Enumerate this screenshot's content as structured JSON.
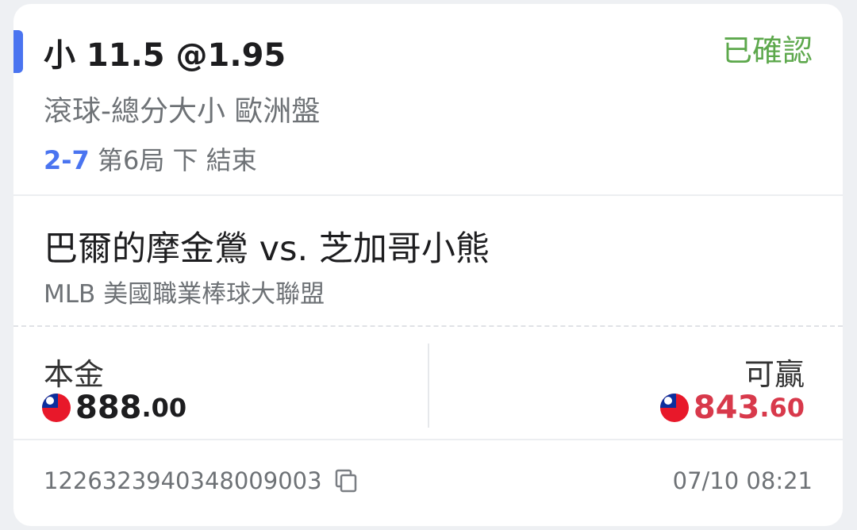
{
  "bet": {
    "selection": "小 11.5 @1.95",
    "status": "已確認",
    "market": "滾球-總分大小 歐洲盤",
    "score": "2-7",
    "period": "第6局 下 結束"
  },
  "match": {
    "teams": "巴爾的摩金鶯 vs. 芝加哥小熊",
    "league": "MLB 美國職業棒球大聯盟"
  },
  "stake": {
    "label": "本金",
    "amount_int": "888",
    "amount_dec": ".00",
    "currency_icon": "taiwan-flag-icon"
  },
  "win": {
    "label": "可贏",
    "amount_int": "843",
    "amount_dec": ".60",
    "currency_icon": "taiwan-flag-icon"
  },
  "footer": {
    "ticket_id": "1226323940348009003",
    "copy_icon": "copy-icon",
    "timestamp": "07/10 08:21"
  },
  "colors": {
    "accent": "#4a74f0",
    "status": "#5da84c",
    "win_amount": "#d8394b",
    "muted_text": "#6e7276"
  }
}
